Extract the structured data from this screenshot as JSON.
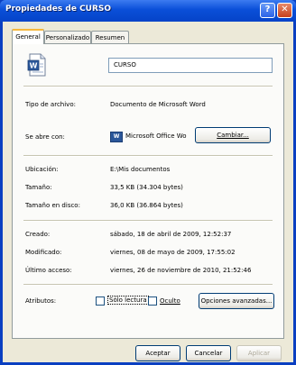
{
  "window": {
    "title": "Propiedades de CURSO"
  },
  "title_buttons": {
    "help": "?",
    "close": "✕"
  },
  "tabs": [
    {
      "label": "General",
      "active": true
    },
    {
      "label": "Personalizado",
      "active": false
    },
    {
      "label": "Resumen",
      "active": false
    }
  ],
  "file": {
    "name": "CURSO",
    "icon": "word-document-icon"
  },
  "properties": {
    "type_label": "Tipo de archivo:",
    "type_value": "Documento de Microsoft Word",
    "opens_label": "Se abre con:",
    "opens_value": "Microsoft Office Wo",
    "change_button": "Cambiar...",
    "location_label": "Ubicación:",
    "location_value": "E:\\Mis documentos",
    "size_label": "Tamaño:",
    "size_value": "33,5 KB (34.304 bytes)",
    "disk_size_label": "Tamaño en disco:",
    "disk_size_value": "36,0 KB (36.864 bytes)",
    "created_label": "Creado:",
    "created_value": "sábado, 18 de abril de 2009, 12:52:37",
    "modified_label": "Modificado:",
    "modified_value": "viernes, 08 de mayo de 2009, 17:55:02",
    "accessed_label": "Último acceso:",
    "accessed_value": "viernes, 26 de noviembre de 2010, 21:52:46"
  },
  "attributes": {
    "label": "Atributos:",
    "readonly": "Sólo lectura",
    "hidden": "Oculto",
    "advanced_button": "Opciones avanzadas..."
  },
  "footer": {
    "accept": "Aceptar",
    "cancel": "Cancelar",
    "apply": "Aplicar"
  }
}
